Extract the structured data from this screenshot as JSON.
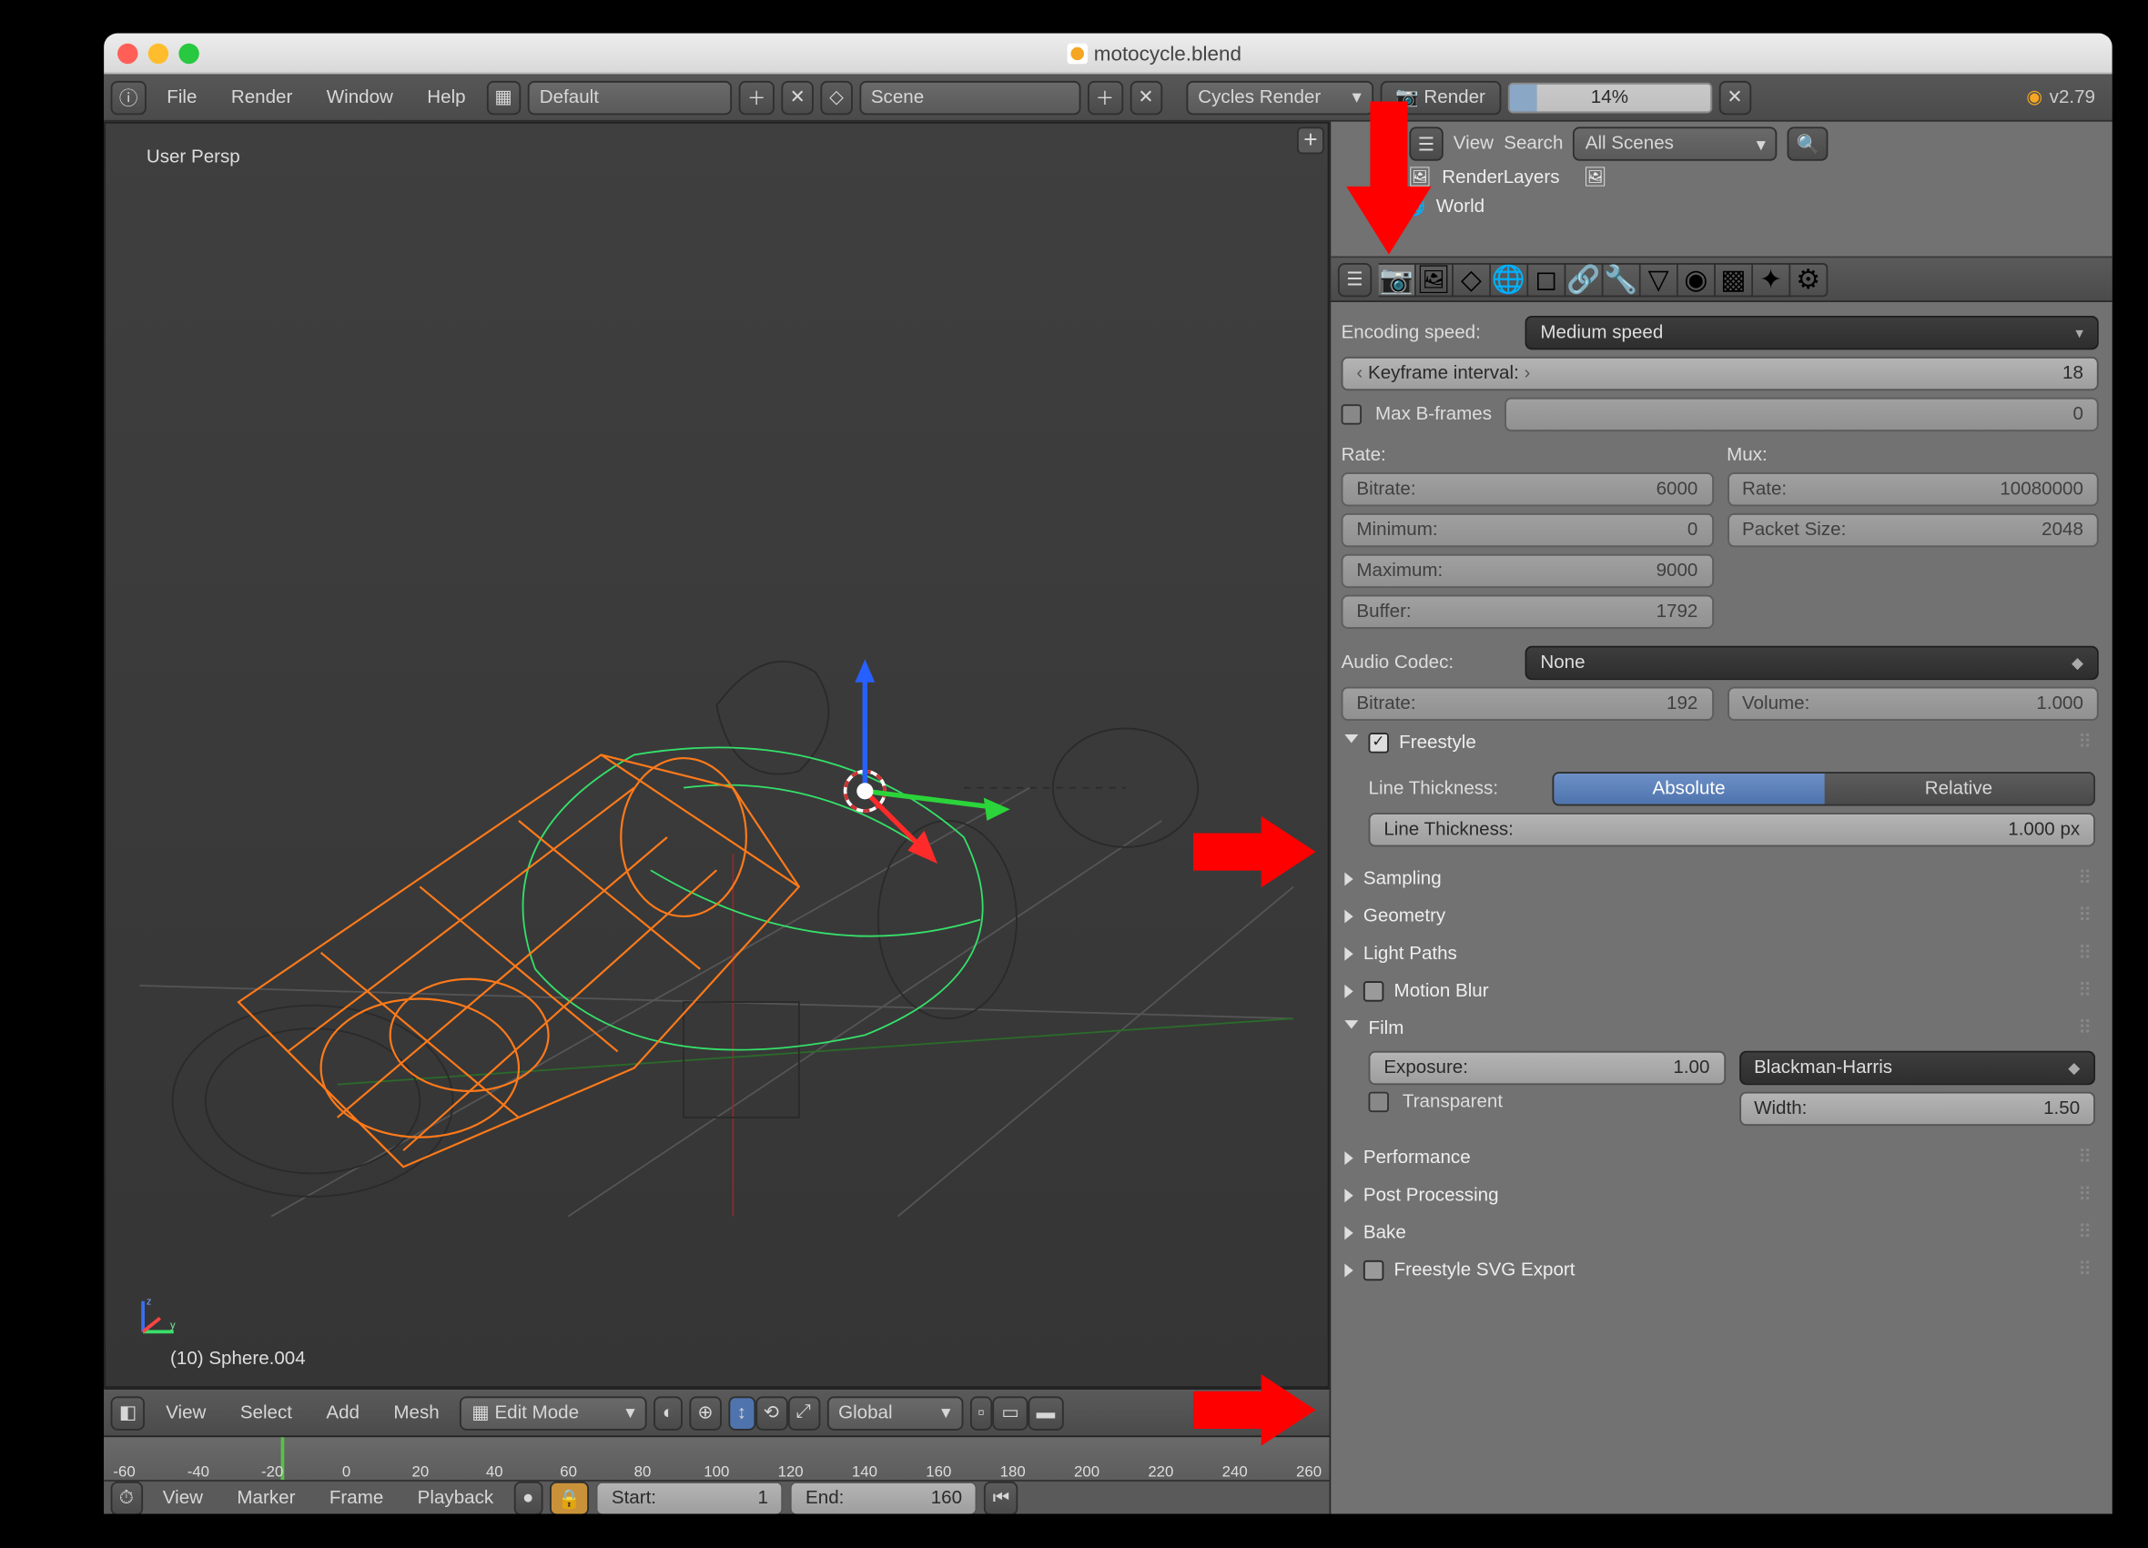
{
  "window": {
    "title": "motocycle.blend"
  },
  "header": {
    "menus": {
      "file": "File",
      "render": "Render",
      "window": "Window",
      "help": "Help"
    },
    "layout": "Default",
    "scene": "Scene",
    "engine": "Cycles Render",
    "render_btn": "Render",
    "progress": "14%",
    "progress_pct": 14,
    "version": "v2.79"
  },
  "outliner": {
    "search_label": "Search",
    "scene_selector": "All Scenes",
    "items": {
      "renderlayers": "RenderLayers",
      "world": "World"
    },
    "view_label": "View"
  },
  "viewport": {
    "persp": "User Persp",
    "selection": "(10) Sphere.004",
    "menus": {
      "view": "View",
      "select": "Select",
      "add": "Add",
      "mesh": "Mesh"
    },
    "mode": "Edit Mode",
    "orientation": "Global"
  },
  "timeline": {
    "ticks": [
      "-60",
      "-40",
      "-20",
      "0",
      "20",
      "40",
      "60",
      "80",
      "100",
      "120",
      "140",
      "160",
      "180",
      "200",
      "220",
      "240",
      "260"
    ],
    "menus": {
      "view": "View",
      "marker": "Marker",
      "frame": "Frame",
      "playback": "Playback"
    },
    "start_label": "Start:",
    "start_val": "1",
    "end_label": "End:",
    "end_val": "160"
  },
  "props": {
    "encoding_speed_label": "Encoding speed:",
    "encoding_speed": "Medium speed",
    "keyframe_label": "Keyframe interval:",
    "keyframe_val": "18",
    "max_bframes_label": "Max B-frames",
    "max_bframes_val": "0",
    "rate_head": "Rate:",
    "mux_head": "Mux:",
    "bitrate_label": "Bitrate:",
    "bitrate_val": "6000",
    "minimum_label": "Minimum:",
    "minimum_val": "0",
    "maximum_label": "Maximum:",
    "maximum_val": "9000",
    "buffer_label": "Buffer:",
    "buffer_val": "1792",
    "mux_rate_label": "Rate:",
    "mux_rate_val": "10080000",
    "packet_label": "Packet Size:",
    "packet_val": "2048",
    "audio_codec_label": "Audio Codec:",
    "audio_codec": "None",
    "audio_bitrate_label": "Bitrate:",
    "audio_bitrate_val": "192",
    "volume_label": "Volume:",
    "volume_val": "1.000",
    "freestyle": "Freestyle",
    "line_thickness_lbl": "Line Thickness:",
    "absolute": "Absolute",
    "relative": "Relative",
    "line_thickness_field": "Line Thickness:",
    "line_thickness_val": "1.000 px",
    "sampling": "Sampling",
    "geometry": "Geometry",
    "light_paths": "Light Paths",
    "motion_blur": "Motion Blur",
    "film": "Film",
    "exposure_label": "Exposure:",
    "exposure_val": "1.00",
    "filter": "Blackman-Harris",
    "transparent": "Transparent",
    "width_label": "Width:",
    "width_val": "1.50",
    "performance": "Performance",
    "post_processing": "Post Processing",
    "bake": "Bake",
    "svg_export": "Freestyle SVG Export"
  }
}
